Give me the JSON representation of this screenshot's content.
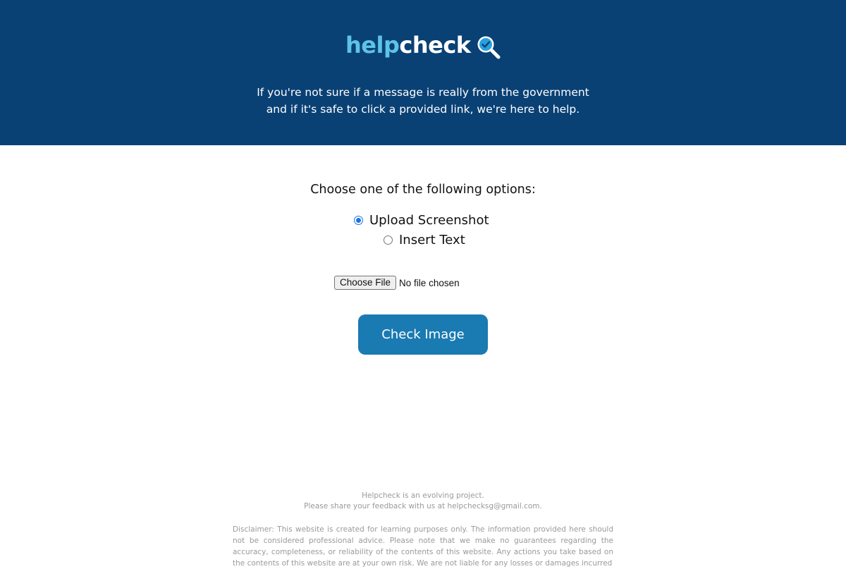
{
  "header": {
    "logo_part1": "help",
    "logo_part2": "check",
    "tagline_line1": "If you're not sure if a message is really from the government",
    "tagline_line2": "and if it's safe to click a provided link, we're here to help.",
    "background_color": "#0a4175",
    "logo_accent_color": "#5ec3e8",
    "logo_icon": "magnifier-check-icon"
  },
  "main": {
    "prompt": "Choose one of the following options:",
    "options": [
      {
        "label": "Upload Screenshot",
        "selected": true
      },
      {
        "label": "Insert Text",
        "selected": false
      }
    ],
    "file_button_label": "Choose File",
    "file_status": "No file chosen",
    "submit_label": "Check Image",
    "button_color": "#1a7ab2"
  },
  "footer": {
    "line1": "Helpcheck is an evolving project.",
    "line2": "Please share your feedback with us at helpchecksg@gmail.com.",
    "disclaimer": "Disclaimer: This website is created for learning purposes only. The information provided here should not be considered professional advice. Please note that we make no guarantees regarding the accuracy, completeness, or reliability of the contents of this website. Any actions you take based on the contents of this website are at your own risk. We are not liable for any losses or damages incurred"
  }
}
